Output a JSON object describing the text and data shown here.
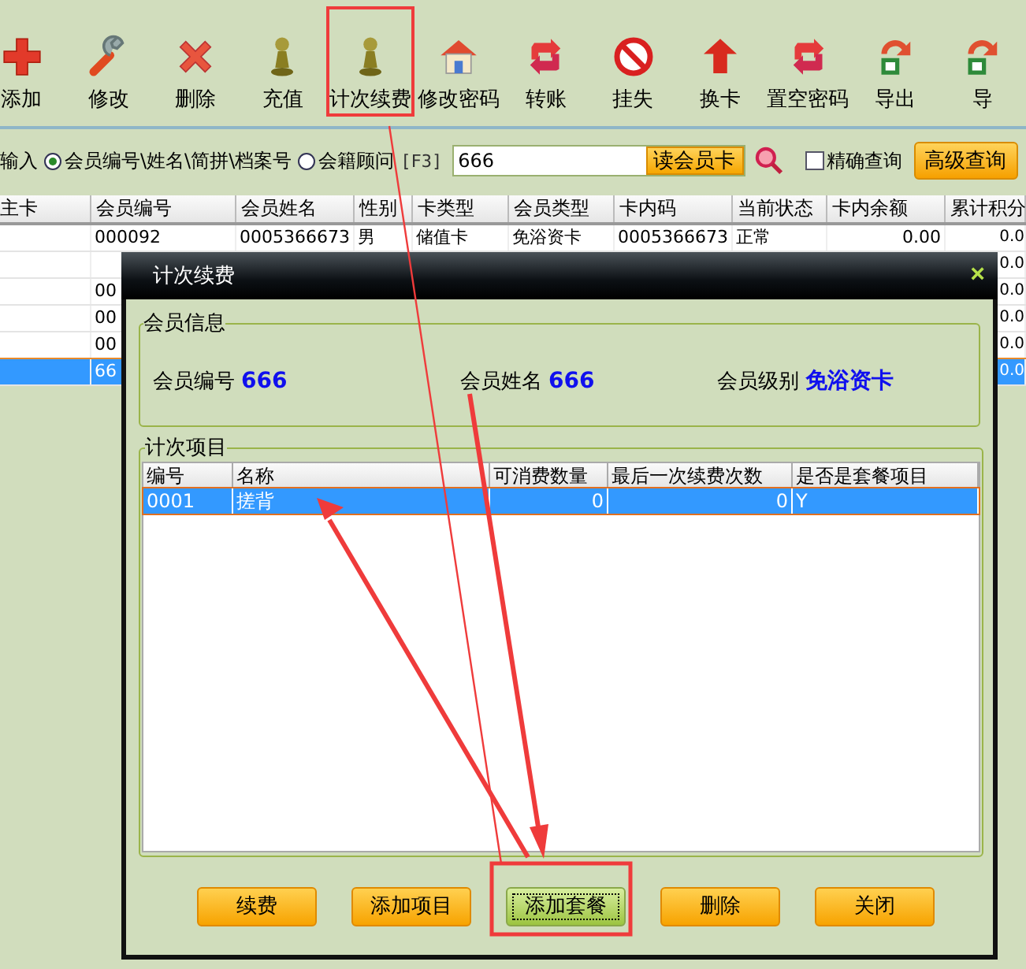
{
  "toolbar": [
    {
      "label": "添加",
      "selected": false
    },
    {
      "label": "修改",
      "selected": false
    },
    {
      "label": "删除",
      "selected": false
    },
    {
      "label": "充值",
      "selected": false
    },
    {
      "label": "计次续费",
      "selected": true
    },
    {
      "label": "修改密码",
      "selected": false
    },
    {
      "label": "转账",
      "selected": false
    },
    {
      "label": "挂失",
      "selected": false
    },
    {
      "label": "换卡",
      "selected": false
    },
    {
      "label": "置空密码",
      "selected": false
    },
    {
      "label": "导出",
      "selected": false
    },
    {
      "label": "导",
      "selected": false
    }
  ],
  "search": {
    "prefix": "输入",
    "options": [
      {
        "label": "会员编号\\姓名\\简拼\\档案号",
        "selected": true
      },
      {
        "label": "会籍顾问",
        "selected": false
      }
    ],
    "hotkey": "[F3]",
    "value": "666",
    "read_card_button": "读会员卡",
    "exact": {
      "label": "精确查询",
      "checked": false
    },
    "advanced_button": "高级查询"
  },
  "table": {
    "columns": [
      "主卡",
      "会员编号",
      "会员姓名",
      "性别",
      "卡类型",
      "会员类型",
      "卡内码",
      "当前状态",
      "卡内余额",
      "累计积分"
    ],
    "rows": [
      {
        "selected": false,
        "cells": [
          "",
          "000092",
          "0005366673",
          "男",
          "储值卡",
          "免浴资卡",
          "0005366673",
          "正常",
          "0.00",
          "0.0"
        ]
      },
      {
        "selected": false,
        "cells": [
          "",
          "",
          "",
          "",
          "",
          "",
          "",
          "",
          "",
          "0.0"
        ]
      },
      {
        "selected": false,
        "cells": [
          "",
          "00",
          "",
          "",
          "",
          "",
          "",
          "",
          "",
          "0.0"
        ]
      },
      {
        "selected": false,
        "cells": [
          "",
          "00",
          "",
          "",
          "",
          "",
          "",
          "",
          "",
          "0.0"
        ]
      },
      {
        "selected": false,
        "cells": [
          "",
          "00",
          "",
          "",
          "",
          "",
          "",
          "",
          "",
          "0.0"
        ]
      },
      {
        "selected": true,
        "cells": [
          "",
          "66",
          "",
          "",
          "",
          "",
          "",
          "",
          "",
          "0.0"
        ]
      }
    ]
  },
  "dialog": {
    "title": "计次续费",
    "close": "×",
    "member_info": {
      "title": "会员信息",
      "fields": [
        {
          "label": "会员编号",
          "value": "666"
        },
        {
          "label": "会员姓名",
          "value": "666"
        },
        {
          "label": "会员级别",
          "value": "免浴资卡"
        }
      ]
    },
    "items": {
      "title": "计次项目",
      "columns": [
        "编号",
        "名称",
        "可消费数量",
        "最后一次续费次数",
        "是否是套餐项目"
      ],
      "rows": [
        {
          "selected": true,
          "cells": [
            "0001",
            "搓背",
            "0",
            "0",
            "Y"
          ]
        }
      ]
    },
    "buttons": [
      {
        "label": "续费",
        "focused": false
      },
      {
        "label": "添加项目",
        "focused": false
      },
      {
        "label": "添加套餐",
        "focused": true
      },
      {
        "label": "删除",
        "focused": false
      },
      {
        "label": "关闭",
        "focused": false
      }
    ]
  }
}
